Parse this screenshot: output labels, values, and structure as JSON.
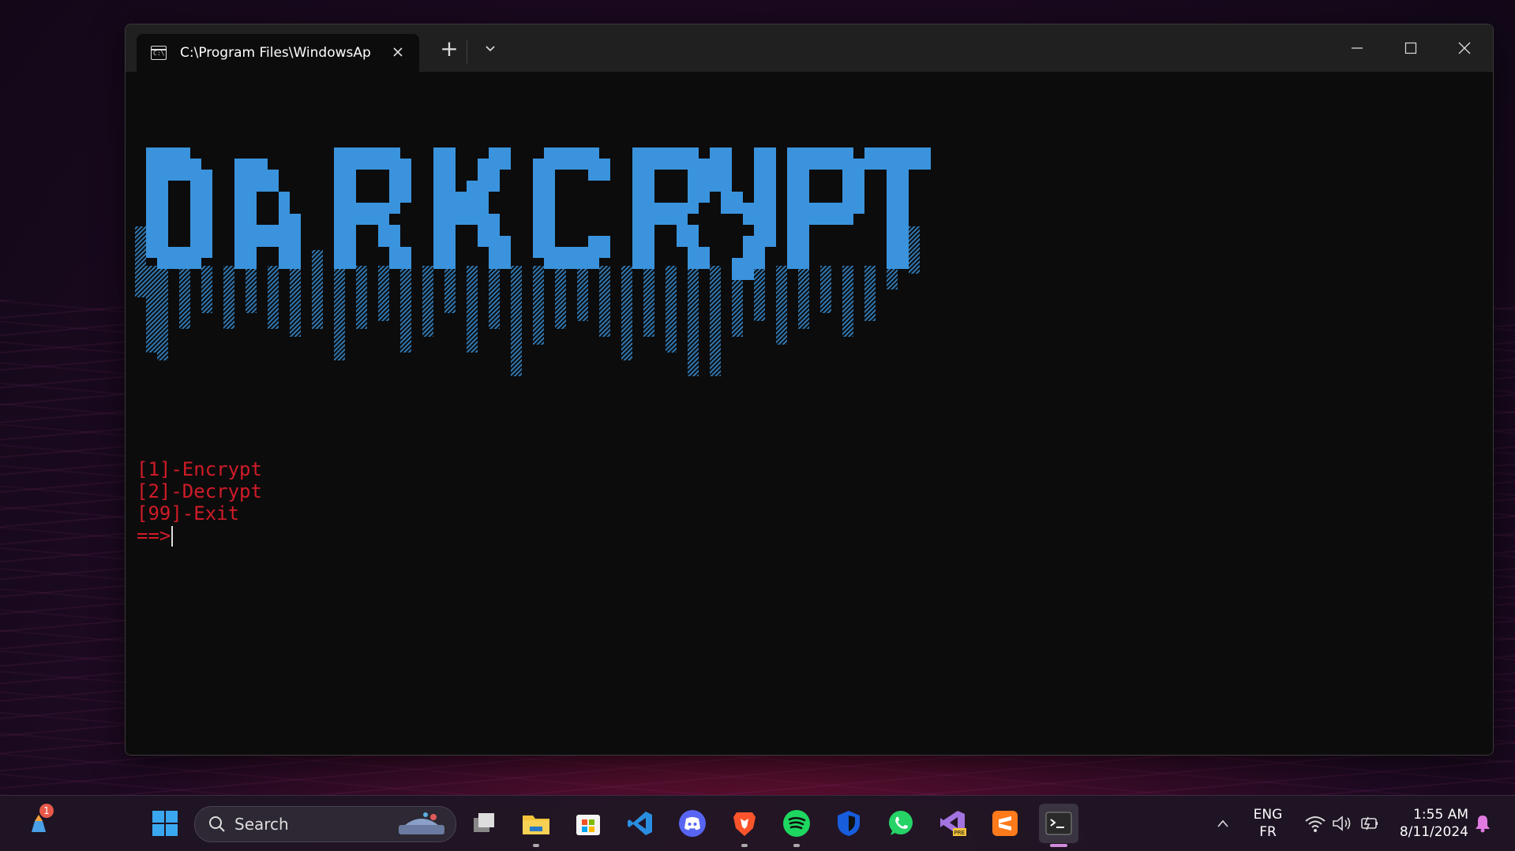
{
  "window": {
    "tab_title": "C:\\Program Files\\WindowsAp",
    "tab_icon_text": "C:\\",
    "new_tab_label": "+",
    "close_glyph": "✕"
  },
  "terminal": {
    "logo_text": "DARKCRYPT",
    "logo_color": "#3a93dc",
    "menu": {
      "item1": "[1]-Encrypt",
      "item2": "[2]-Decrypt",
      "item3": "[99]-Exit",
      "prompt": "==>"
    },
    "text_color": "#d01c28"
  },
  "taskbar": {
    "weather_badge": "1",
    "search_label": "Search",
    "apps": [
      "start-icon",
      "task-view-icon",
      "file-explorer-icon",
      "microsoft-store-icon",
      "vscode-icon",
      "discord-icon",
      "brave-icon",
      "spotify-icon",
      "bitwarden-icon",
      "whatsapp-icon",
      "visual-studio-preview-icon",
      "sublime-text-icon",
      "terminal-icon"
    ],
    "lang_top": "ENG",
    "lang_bottom": "FR",
    "time": "1:55 AM",
    "date": "8/11/2024"
  }
}
